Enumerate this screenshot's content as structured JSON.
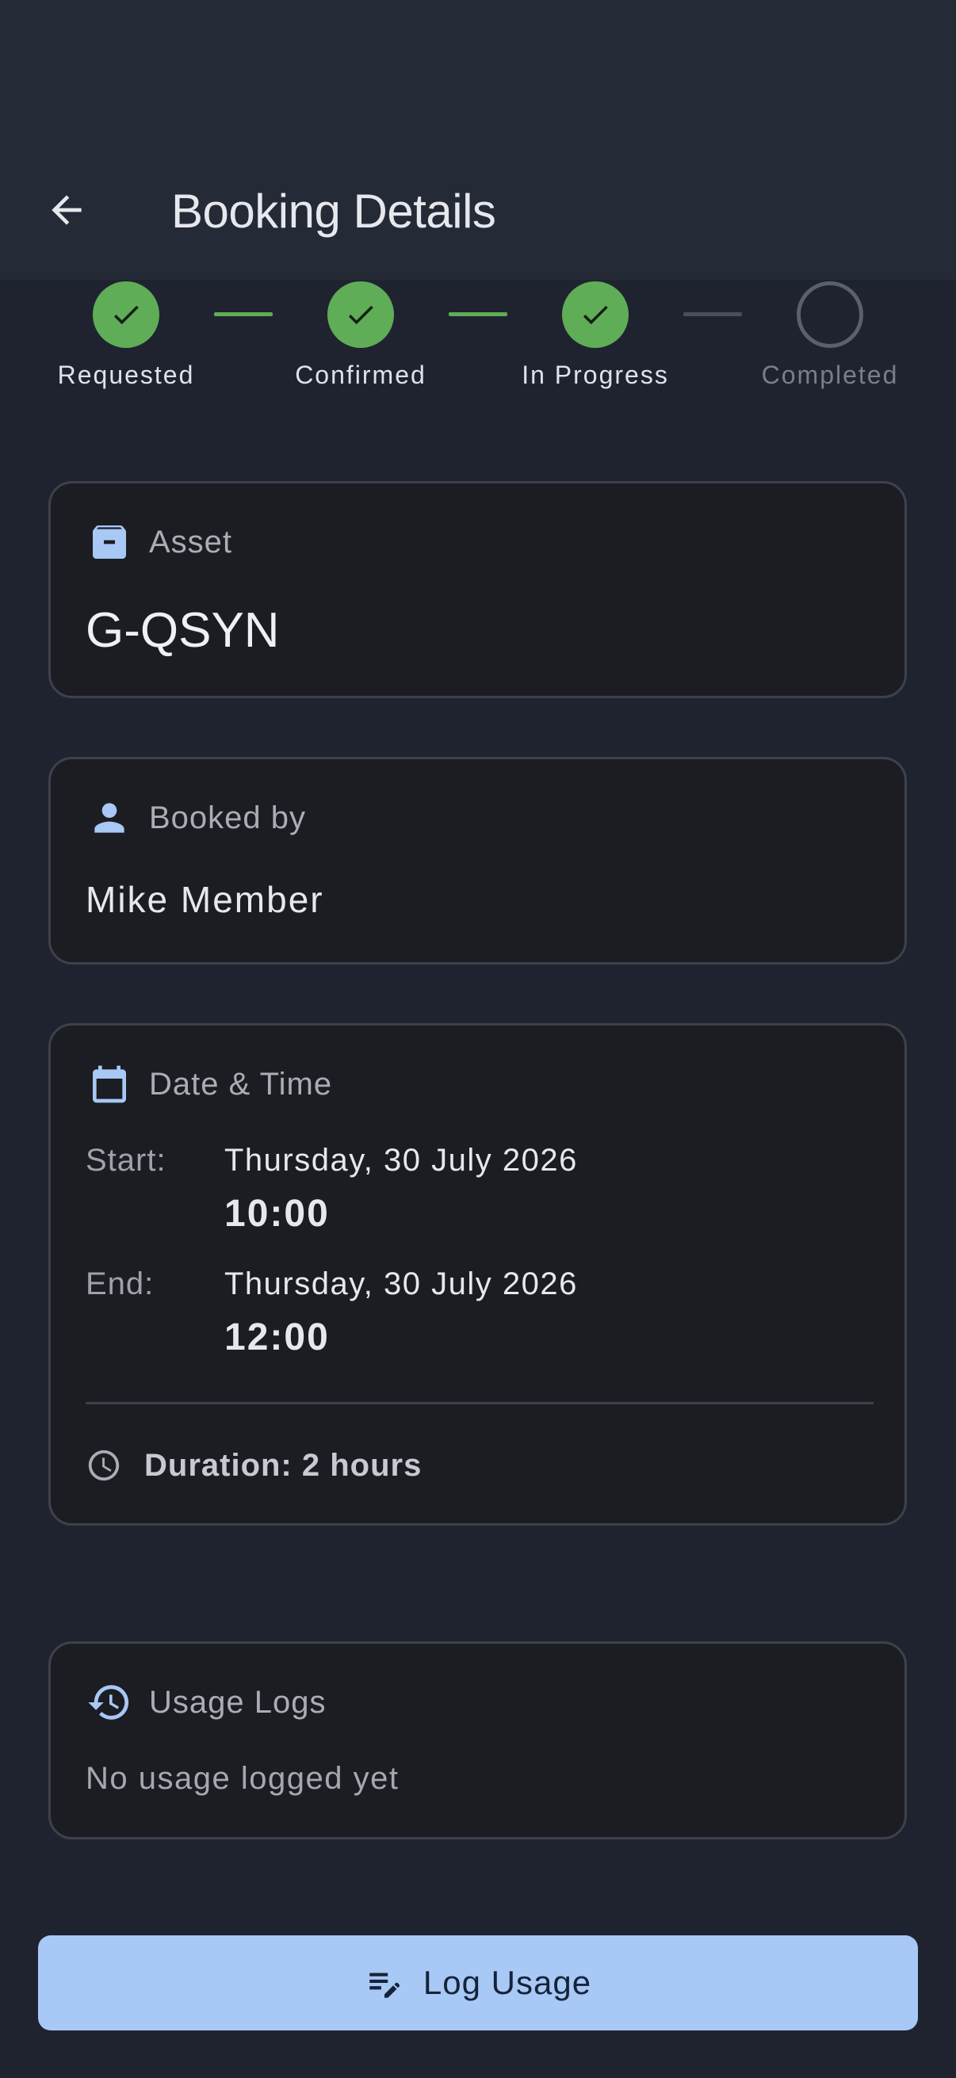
{
  "appbar": {
    "title": "Booking Details"
  },
  "stepper": {
    "steps": [
      {
        "label": "Requested",
        "status": "done"
      },
      {
        "label": "Confirmed",
        "status": "done"
      },
      {
        "label": "In Progress",
        "status": "done"
      },
      {
        "label": "Completed",
        "status": "pending"
      }
    ]
  },
  "asset": {
    "label": "Asset",
    "value": "G-QSYN",
    "icon": "archive-icon"
  },
  "booked_by": {
    "label": "Booked by",
    "value": "Mike Member",
    "icon": "person-icon"
  },
  "date_time": {
    "label": "Date & Time",
    "icon": "calendar-icon",
    "start_label": "Start:",
    "start_date": "Thursday, 30 July 2026",
    "start_time": "10:00",
    "end_label": "End:",
    "end_date": "Thursday, 30 July 2026",
    "end_time": "12:00",
    "duration": "Duration: 2 hours"
  },
  "usage_logs": {
    "label": "Usage Logs",
    "icon": "history-icon",
    "empty_text": "No usage logged yet"
  },
  "actions": {
    "log_usage_label": "Log Usage",
    "icon": "edit-note-icon"
  },
  "colors": {
    "background": "#1f2330",
    "appbar": "#252a37",
    "card": "#1b1d22",
    "step_done": "#5fad56",
    "accent": "#a8c8f5"
  }
}
